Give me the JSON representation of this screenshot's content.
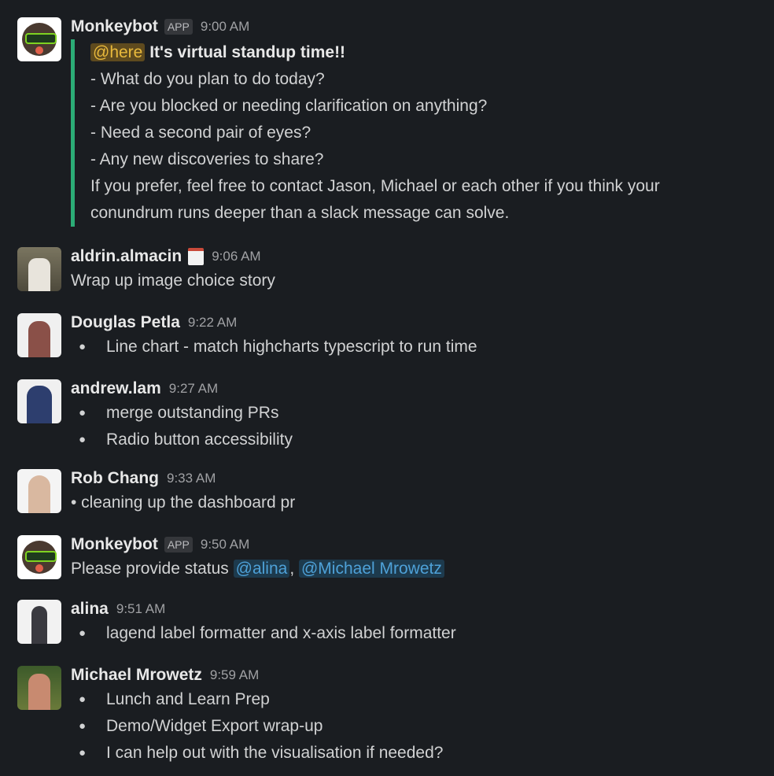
{
  "colors": {
    "background": "#1a1d21",
    "quote_bar": "#2bac76",
    "here_bg": "#5e4a1e",
    "mention": "#4ea1d8"
  },
  "messages": [
    {
      "name": "Monkeybot",
      "badge": "APP",
      "time": "9:00 AM",
      "here": "@here",
      "title": "It's virtual standup time!!",
      "lines": [
        "- What do you plan to do today?",
        "- Are you blocked or needing clarification on anything?",
        "- Need a second pair of eyes?",
        "- Any new discoveries to share?",
        "If you prefer, feel free to contact Jason, Michael or each other if you think your",
        "conundrum runs deeper than a slack message can solve."
      ]
    },
    {
      "name": "aldrin.almacin",
      "status_icon": "calendar-icon",
      "time": "9:06 AM",
      "text": "Wrap up image choice story"
    },
    {
      "name": "Douglas Petla",
      "time": "9:22 AM",
      "bullets": [
        "Line chart - match highcharts typescript to run time"
      ]
    },
    {
      "name": "andrew.lam",
      "time": "9:27 AM",
      "bullets": [
        "merge outstanding PRs",
        "Radio button accessibility"
      ]
    },
    {
      "name": "Rob Chang",
      "time": "9:33 AM",
      "text": "• cleaning up the dashboard pr"
    },
    {
      "name": "Monkeybot",
      "badge": "APP",
      "time": "9:50 AM",
      "text": "Please provide status ",
      "mention1": "@alina",
      "sep": ", ",
      "mention2": "@Michael Mrowetz"
    },
    {
      "name": "alina",
      "time": "9:51 AM",
      "bullets": [
        "lagend label formatter and x-axis label formatter"
      ]
    },
    {
      "name": "Michael Mrowetz",
      "time": "9:59 AM",
      "bullets": [
        "Lunch and Learn Prep",
        "Demo/Widget Export wrap-up",
        "I can help out with the visualisation if needed?"
      ]
    }
  ],
  "bullet": "●"
}
